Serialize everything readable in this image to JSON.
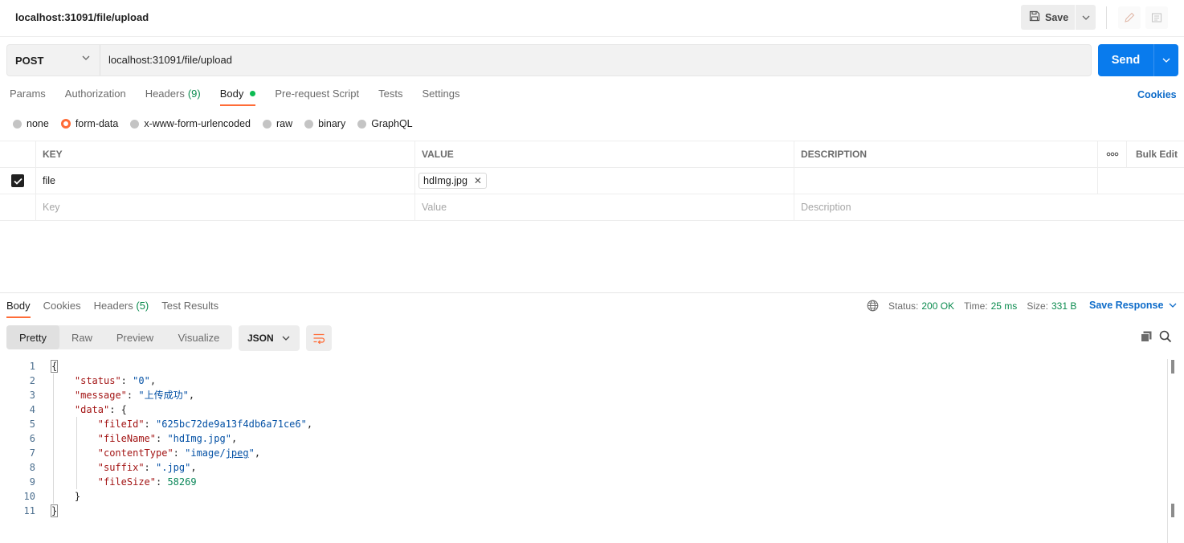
{
  "window": {
    "title": "localhost:31091/file/upload"
  },
  "toolbar": {
    "save_label": "Save"
  },
  "request": {
    "method": "POST",
    "url": "localhost:31091/file/upload",
    "send_label": "Send",
    "tabs": [
      {
        "label": "Params"
      },
      {
        "label": "Authorization"
      },
      {
        "label": "Headers",
        "count": "(9)"
      },
      {
        "label": "Body"
      },
      {
        "label": "Pre-request Script"
      },
      {
        "label": "Tests"
      },
      {
        "label": "Settings"
      }
    ],
    "cookies_label": "Cookies",
    "body_types": [
      "none",
      "form-data",
      "x-www-form-urlencoded",
      "raw",
      "binary",
      "GraphQL"
    ],
    "body_type_selected": "form-data"
  },
  "params_table": {
    "headers": {
      "key": "KEY",
      "value": "VALUE",
      "description": "DESCRIPTION",
      "bulk_edit": "Bulk Edit"
    },
    "rows": [
      {
        "checked": true,
        "key": "file",
        "value": "hdImg.jpg",
        "description": ""
      }
    ],
    "placeholders": {
      "key": "Key",
      "value": "Value",
      "description": "Description"
    }
  },
  "response": {
    "tabs": [
      {
        "label": "Body"
      },
      {
        "label": "Cookies"
      },
      {
        "label": "Headers",
        "count": "(5)"
      },
      {
        "label": "Test Results"
      }
    ],
    "status_label": "Status:",
    "status_value": "200 OK",
    "time_label": "Time:",
    "time_value": "25 ms",
    "size_label": "Size:",
    "size_value": "331 B",
    "save_response_label": "Save Response",
    "formats": [
      "Pretty",
      "Raw",
      "Preview",
      "Visualize"
    ],
    "format_selected": "Pretty",
    "language": "JSON",
    "code_lines": [
      {
        "n": "1",
        "indent": 0,
        "parts": [
          [
            "p",
            "{"
          ]
        ]
      },
      {
        "n": "2",
        "indent": 1,
        "parts": [
          [
            "k",
            "\"status\""
          ],
          [
            "p",
            ": "
          ],
          [
            "s",
            "\"0\""
          ],
          [
            "p",
            ","
          ]
        ]
      },
      {
        "n": "3",
        "indent": 1,
        "parts": [
          [
            "k",
            "\"message\""
          ],
          [
            "p",
            ": "
          ],
          [
            "s",
            "\"上传成功\""
          ],
          [
            "p",
            ","
          ]
        ]
      },
      {
        "n": "4",
        "indent": 1,
        "parts": [
          [
            "k",
            "\"data\""
          ],
          [
            "p",
            ": {"
          ]
        ]
      },
      {
        "n": "5",
        "indent": 2,
        "parts": [
          [
            "k",
            "\"fileId\""
          ],
          [
            "p",
            ": "
          ],
          [
            "s",
            "\"625bc72de9a13f4db6a71ce6\""
          ],
          [
            "p",
            ","
          ]
        ]
      },
      {
        "n": "6",
        "indent": 2,
        "parts": [
          [
            "k",
            "\"fileName\""
          ],
          [
            "p",
            ": "
          ],
          [
            "s",
            "\"hdImg.jpg\""
          ],
          [
            "p",
            ","
          ]
        ]
      },
      {
        "n": "7",
        "indent": 2,
        "parts": [
          [
            "k",
            "\"contentType\""
          ],
          [
            "p",
            ": "
          ],
          [
            "s",
            "\"image/jpeg\""
          ],
          [
            "p",
            ","
          ]
        ]
      },
      {
        "n": "8",
        "indent": 2,
        "parts": [
          [
            "k",
            "\"suffix\""
          ],
          [
            "p",
            ": "
          ],
          [
            "s",
            "\".jpg\""
          ],
          [
            "p",
            ","
          ]
        ]
      },
      {
        "n": "9",
        "indent": 2,
        "parts": [
          [
            "k",
            "\"fileSize\""
          ],
          [
            "p",
            ": "
          ],
          [
            "n",
            "58269"
          ]
        ]
      },
      {
        "n": "10",
        "indent": 1,
        "parts": [
          [
            "p",
            "}"
          ]
        ]
      },
      {
        "n": "11",
        "indent": 0,
        "parts": [
          [
            "p",
            "}"
          ]
        ]
      }
    ]
  },
  "colors": {
    "accent": "#ff6c37",
    "primary": "#097bed",
    "success": "#0a8b4e",
    "link": "#0d6bc9"
  }
}
